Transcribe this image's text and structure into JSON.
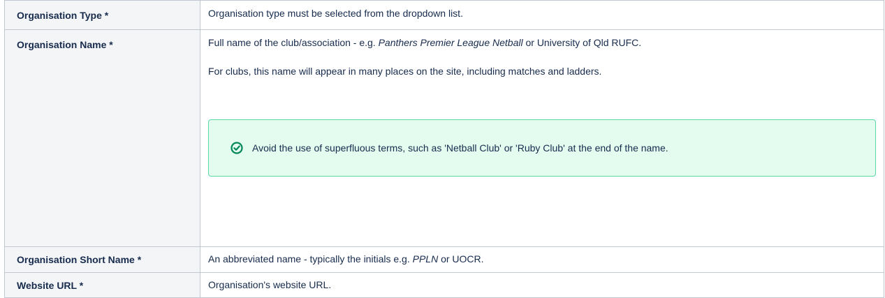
{
  "rows": [
    {
      "label": "Organisation Type *",
      "description": "Organisation type must be selected from the dropdown list."
    },
    {
      "label": "Organisation Name *",
      "desc_pre": "Full name of the club/association - e.g. ",
      "desc_em": "Panthers Premier League Netball",
      "desc_post": " or University of Qld RUFC.",
      "desc_line2": "For clubs, this name will appear in many places on the site, including matches and ladders.",
      "panel": {
        "icon": "check-circle-icon",
        "text": "Avoid the use of superfluous terms, such as 'Netball Club' or 'Ruby Club' at the end of the name.",
        "border_color": "#57d9a3",
        "background_color": "#e3fcef",
        "icon_color": "#00875a"
      }
    },
    {
      "label": "Organisation Short Name *",
      "desc_pre": "An abbreviated name - typically the initials e.g. ",
      "desc_em": "PPLN",
      "desc_post": " or UOCR."
    },
    {
      "label": "Website URL *",
      "description": "Organisation's website URL."
    }
  ],
  "colors": {
    "label_background": "#f4f5f7",
    "border": "#c1c7d0",
    "text": "#172b4d"
  }
}
